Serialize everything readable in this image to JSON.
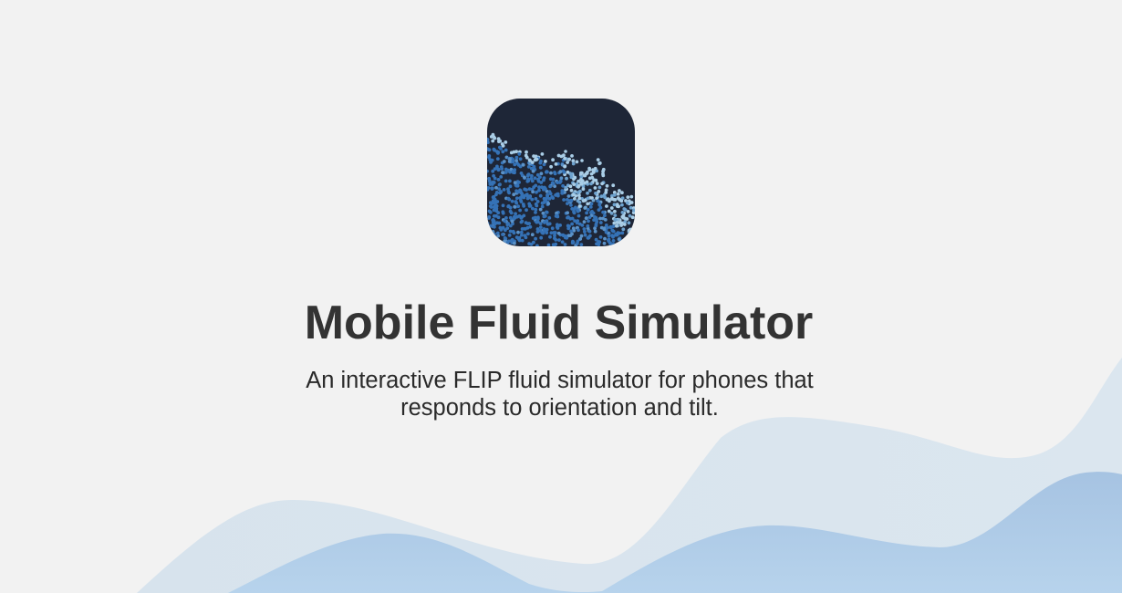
{
  "page": {
    "title": "Mobile Fluid Simulator",
    "subtitle_line1": "An interactive FLIP fluid simulator for phones that",
    "subtitle_line2": "responds to orientation and tilt."
  },
  "icons": {
    "app_icon": "fluid-particles-icon"
  },
  "colors": {
    "background": "#f2f2f2",
    "icon_background": "#1e2637",
    "particle_deep": "#3572b6",
    "particle_light": "#a9cde6",
    "title_text": "#333333",
    "wave_light": "#d8e4ee",
    "wave_mid": "#a9c7e3"
  }
}
